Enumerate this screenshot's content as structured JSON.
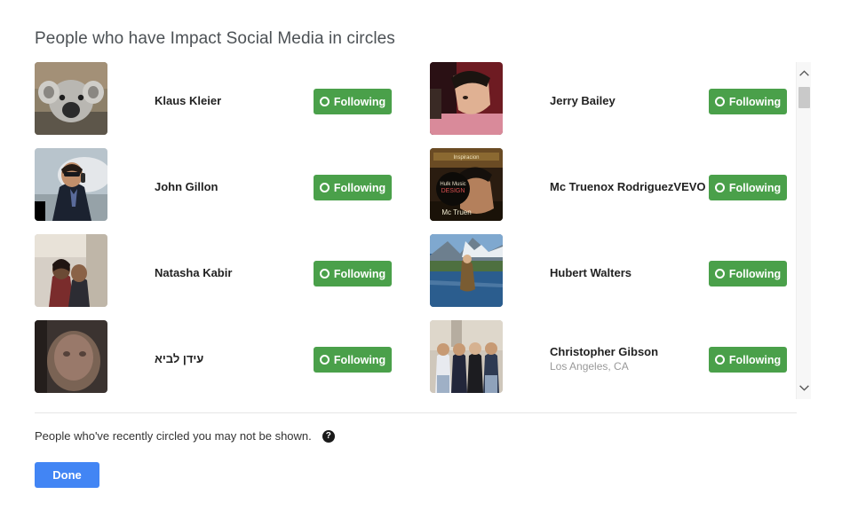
{
  "header": {
    "title": "People who have Impact Social Media in circles"
  },
  "colors": {
    "follow_green": "#4aa04a",
    "done_blue": "#4285f4",
    "title_gray": "#4c5155",
    "name_black": "#222222",
    "sub_gray": "#999999"
  },
  "list": {
    "people": [
      {
        "name": "Klaus Kleier",
        "subtitle": "",
        "button_label": "Following",
        "button_icon": "circle-ring-icon",
        "avatar": "koala-photo",
        "column": "left"
      },
      {
        "name": "Jerry Bailey",
        "subtitle": "",
        "button_label": "Following",
        "button_icon": "circle-ring-icon",
        "avatar": "young-man-portrait-photo",
        "column": "right"
      },
      {
        "name": "John Gillon",
        "subtitle": "",
        "button_label": "Following",
        "button_icon": "circle-ring-icon",
        "avatar": "man-in-suit-with-phone-photo",
        "column": "left"
      },
      {
        "name": "Mc Truenox RodriguezVEVO",
        "subtitle": "",
        "button_label": "Following",
        "button_icon": "circle-ring-icon",
        "avatar": "music-album-cover-photo",
        "column": "right"
      },
      {
        "name": "Natasha Kabir",
        "subtitle": "",
        "button_label": "Following",
        "button_icon": "circle-ring-icon",
        "avatar": "couple-indoors-photo",
        "column": "left"
      },
      {
        "name": "Hubert Walters",
        "subtitle": "",
        "button_label": "Following",
        "button_icon": "circle-ring-icon",
        "avatar": "fisherman-in-river-photo",
        "column": "right"
      },
      {
        "name": "עידן לביא",
        "subtitle": "",
        "button_label": "Following",
        "button_icon": "circle-ring-icon",
        "avatar": "blurred-face-photo",
        "column": "left"
      },
      {
        "name": "Christopher Gibson",
        "subtitle": "Los Angeles, CA",
        "button_label": "Following",
        "button_icon": "circle-ring-icon",
        "avatar": "group-of-men-street-photo",
        "column": "right"
      }
    ]
  },
  "scrollbar": {
    "up_arrow_icon": "chevron-up-icon",
    "down_arrow_icon": "chevron-down-icon"
  },
  "footer": {
    "note": "People who've recently circled you may not be shown.",
    "help_icon": "help-question-icon",
    "help_label": "?",
    "done_label": "Done"
  }
}
